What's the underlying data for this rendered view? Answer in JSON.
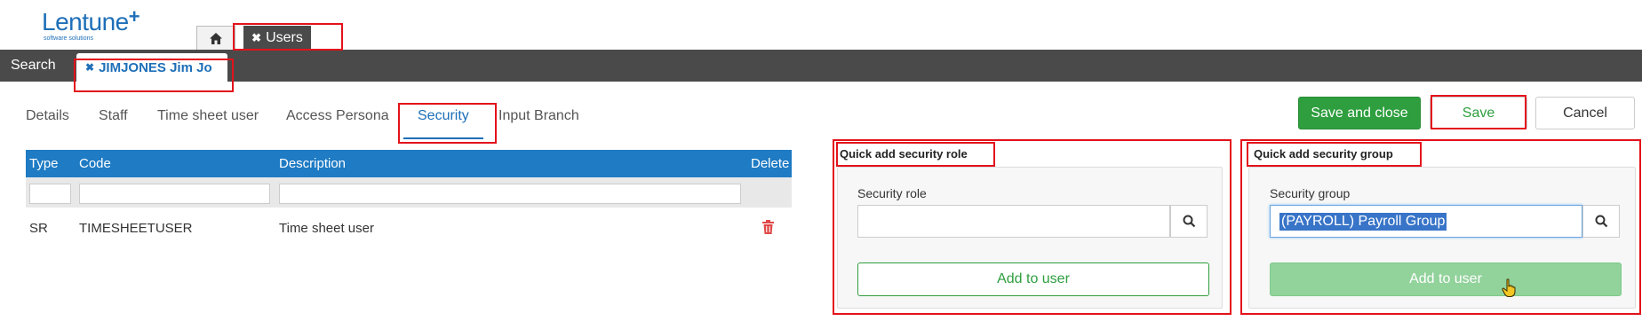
{
  "logo": {
    "name": "Lentune",
    "plus": "+",
    "tagline": "software solutions"
  },
  "top_tabs": {
    "home_icon": "home-icon",
    "users_label": "Users",
    "close_glyph": "✖"
  },
  "subbar": {
    "search_label": "Search",
    "user_tab_label": "JIMJONES Jim Jo",
    "close_glyph": "✖"
  },
  "nav_tabs": [
    {
      "label": "Details"
    },
    {
      "label": "Staff"
    },
    {
      "label": "Time sheet user"
    },
    {
      "label": "Access Persona"
    },
    {
      "label": "Security",
      "active": true
    },
    {
      "label": "Input Branch"
    }
  ],
  "actions": {
    "save_close": "Save and close",
    "save": "Save",
    "cancel": "Cancel"
  },
  "grid": {
    "columns": [
      "Type",
      "Code",
      "Description",
      "Delete"
    ],
    "rows": [
      {
        "type": "SR",
        "code": "TIMESHEETUSER",
        "description": "Time sheet user",
        "delete_icon": "trash-icon"
      }
    ]
  },
  "quick_role": {
    "title": "Quick add security role",
    "field_label": "Security role",
    "value": "",
    "button": "Add to user"
  },
  "quick_group": {
    "title": "Quick add security group",
    "field_label": "Security group",
    "value": "(PAYROLL) Payroll Group",
    "button": "Add to user"
  },
  "colors": {
    "brand": "#1e6fb8",
    "green": "#2e9e3e",
    "header_blue": "#1e7bc4",
    "dark_bar": "#4a4a4a",
    "highlight": "#e3121b"
  }
}
